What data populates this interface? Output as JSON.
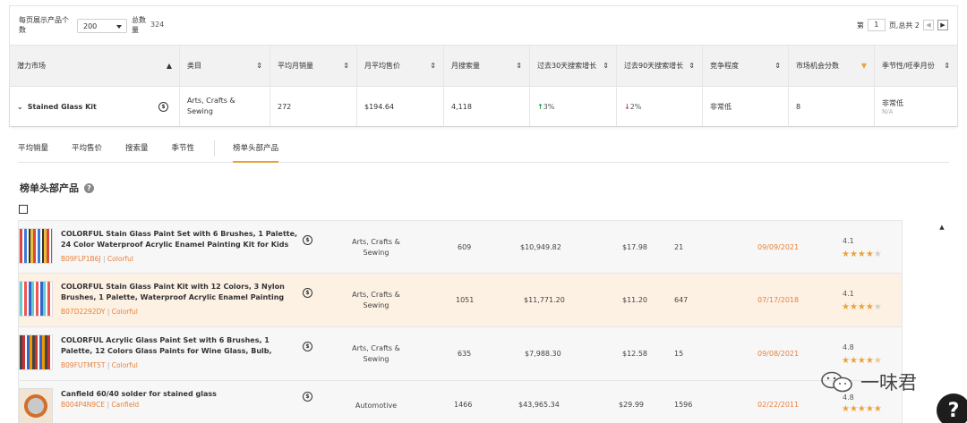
{
  "pagination": {
    "per_page_label": "每页展示产品个数",
    "per_page_value": "200",
    "total_label": "总数量",
    "total_value": "324",
    "page_prefix": "第",
    "page_value": "1",
    "page_suffix": "页,总共 2",
    "prev_icon": "chevron-left-icon",
    "next_icon": "caret-right-icon"
  },
  "market_table": {
    "headers": [
      "潜力市场",
      "类目",
      "平均月销量",
      "月平均售价",
      "月搜索量",
      "过去30天搜索增长",
      "过去90天搜索增长",
      "竞争程度",
      "市场机会分数",
      "季节性/旺季月份"
    ],
    "row": {
      "name": "Stained Glass Kit",
      "category": "Arts, Crafts & Sewing",
      "avg_monthly_sales": "272",
      "avg_price": "$194.64",
      "search_volume": "4,118",
      "growth_30d": "3%",
      "growth_30d_dir": "up",
      "growth_90d": "2%",
      "growth_90d_dir": "down",
      "competition": "非常低",
      "opportunity_score": "8",
      "seasonality": "非常低",
      "peak_months": "N/A"
    }
  },
  "tabs": [
    "平均销量",
    "平均售价",
    "搜索量",
    "季节性",
    "榜单头部产品"
  ],
  "active_tab": "榜单头部产品",
  "section": {
    "title": "榜单头部产品",
    "help_icon": "question-icon"
  },
  "products": [
    {
      "title": "COLORFUL Stain Glass Paint Set with 6 Brushes, 1 Palette, 24 Color Waterproof Acrylic Enamel Painting Kit for Kids to Arts...",
      "asin": "B09FLP1B6J",
      "brand": "Colorful",
      "category": "Arts, Crafts & Sewing",
      "monthly_sales": "609",
      "revenue": "$10,949.82",
      "price": "$17.98",
      "reviews": "21",
      "date": "09/09/2021",
      "rating": "4.1",
      "stars": 4
    },
    {
      "title": "COLORFUL Stain Glass Paint Kit with 12 Colors, 3 Nylon Brushes, 1 Palette, Waterproof Acrylic Enamel Painting Set t...",
      "asin": "B07D2292DY",
      "brand": "Colorful",
      "category": "Arts, Crafts & Sewing",
      "monthly_sales": "1051",
      "revenue": "$11,771.20",
      "price": "$11.20",
      "reviews": "647",
      "date": "07/17/2018",
      "rating": "4.1",
      "stars": 4
    },
    {
      "title": "COLORFUL Acrylic Glass Paint Set with 6 Brushes, 1 Palette, 12 Colors Glass Paints for Wine Glass, Bulb, Waterproof...",
      "asin": "B09FUTMT5T",
      "brand": "Colorful",
      "category": "Arts, Crafts & Sewing",
      "monthly_sales": "635",
      "revenue": "$7,988.30",
      "price": "$12.58",
      "reviews": "15",
      "date": "09/08/2021",
      "rating": "4.8",
      "stars": 4.5
    },
    {
      "title": "Canfield 60/40 solder for stained glass",
      "asin": "B004P4N9CE",
      "brand": "Canfield",
      "category": "Automotive",
      "monthly_sales": "1466",
      "revenue": "$43,965.34",
      "price": "$29.99",
      "reviews": "1596",
      "date": "02/22/2011",
      "rating": "4.8",
      "stars": 5
    }
  ],
  "watermark": {
    "text": "一味君",
    "icon": "wechat-icon"
  },
  "help_button": "?",
  "colors": {
    "accent": "#e8a33b",
    "link": "#e8813b",
    "up": "#1a9c3c",
    "down": "#d8404a",
    "highlight_row": "#fdf1e3"
  }
}
